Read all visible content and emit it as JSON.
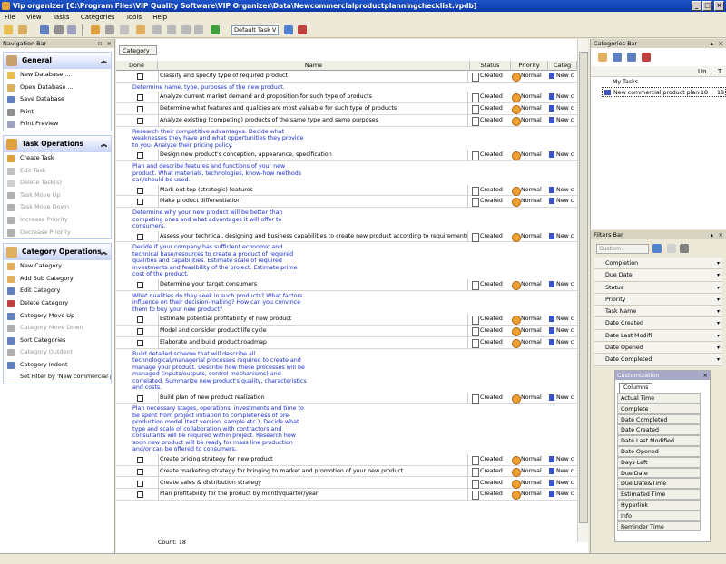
{
  "window": {
    "title": "Vip organizer [C:\\Program Files\\VIP Quality Software\\VIP Organizer\\Data\\Newcommercialproductplanningchecklist.vpdb]"
  },
  "menu": [
    "File",
    "View",
    "Tasks",
    "Categories",
    "Tools",
    "Help"
  ],
  "toolbar": {
    "filter": "Default Task V"
  },
  "nav": {
    "title": "Navigation Bar",
    "general": {
      "title": "General",
      "items": [
        "New Database ...",
        "Open Database ...",
        "Save Database",
        "Print",
        "Print Preview"
      ]
    },
    "tasks": {
      "title": "Task Operations",
      "items": [
        "Create Task",
        "Edit Task",
        "Delete Task(s)",
        "Task Move Up",
        "Task Move Down",
        "Increase Priority",
        "Decrease Priority"
      ]
    },
    "cats": {
      "title": "Category Operations",
      "items": [
        "New Category",
        "Add Sub Category",
        "Edit Category",
        "Delete Category",
        "Category Move Up",
        "Category Move Down",
        "Sort Categories",
        "Category Outdent",
        "Category Indent",
        "Set Filter by 'New commercial p..."
      ]
    }
  },
  "main": {
    "tab": "Category",
    "cols": {
      "done": "Done",
      "name": "Name",
      "status": "Status",
      "priority": "Priority",
      "cat": "Categ"
    },
    "count": "Count: 18",
    "rows": [
      {
        "name": "Classify and specify type of required product",
        "status": "Created",
        "priority": "Normal",
        "cat": "New c",
        "note": "Determine name, type, purposes of the new product."
      },
      {
        "name": "Analyze current market demand and proposition for such type of products",
        "status": "Created",
        "priority": "Normal",
        "cat": "New c"
      },
      {
        "name": "Determine what features and qualities are most valuable for such type of products",
        "status": "Created",
        "priority": "Normal",
        "cat": "New c"
      },
      {
        "name": "Analyze existing (competing) products of the same type and same purposes",
        "status": "Created",
        "priority": "Normal",
        "cat": "New c",
        "note": "Research their competitive advantages. Decide what\nweaknesses they have and what opportunities they provide\nto you. Analyze their pricing policy."
      },
      {
        "name": "Design new product's conception, appearance, specification",
        "status": "Created",
        "priority": "Normal",
        "cat": "New c",
        "note": "Plan and describe features and functions of your new\nproduct. What materials, technologies, know-how methods\ncan/should be used."
      },
      {
        "name": "Mark out top (strategic) features",
        "status": "Created",
        "priority": "Normal",
        "cat": "New c"
      },
      {
        "name": "Make product differentiation",
        "status": "Created",
        "priority": "Normal",
        "cat": "New c",
        "note": "Determine why your new product will be better than\ncompeting ones and what advantages it will offer to\nconsumers."
      },
      {
        "name": "Assess your technical, designing and business capabilities to create new product according to requirements",
        "status": "Created",
        "priority": "Normal",
        "cat": "New c",
        "note": "Decide if your company has sufficient economic and\ntechnical base/resources to create a product of required\nqualities and capabilities. Estimate scale of required\ninvestments and feasibility of the project. Estimate prime\ncost of the product."
      },
      {
        "name": "Determine your target consumers",
        "status": "Created",
        "priority": "Normal",
        "cat": "New c",
        "note": "What qualities do they seek in such products? What factors\ninfluence on their decision-making? How can you convince\nthem to buy your new product?"
      },
      {
        "name": "Estimate potential profitability of new product",
        "status": "Created",
        "priority": "Normal",
        "cat": "New c"
      },
      {
        "name": "Model and consider product life cycle",
        "status": "Created",
        "priority": "Normal",
        "cat": "New c"
      },
      {
        "name": "Elaborate and build product roadmap",
        "status": "Created",
        "priority": "Normal",
        "cat": "New c",
        "note": "Build detailed scheme that will describe all\ntechnological/managerial processes required to create and\nmanage your product. Describe how these processes will be\nmanaged (inputs/outputs, control mechanisms) and\ncorrelated. Summarize new product's quality, characteristics\nand costs."
      },
      {
        "name": "Build plan of new product realization",
        "status": "Created",
        "priority": "Normal",
        "cat": "New c",
        "note": "Plan necessary stages, operations, investments and time to\nbe spent from project initiation to completeness of pre-\nproduction model (test version, sample etc.). Decide what\ntype and scale of collaboration with contractors and\nconsultants will be required within project. Research how\nsoon new product will be ready for mass line production\nand/or can be offered to consumers."
      },
      {
        "name": "Create pricing strategy for new product",
        "status": "Created",
        "priority": "Normal",
        "cat": "New c"
      },
      {
        "name": "Create marketing strategy for bringing to market and promotion of your new product",
        "status": "Created",
        "priority": "Normal",
        "cat": "New c"
      },
      {
        "name": "Create sales & distribution strategy",
        "status": "Created",
        "priority": "Normal",
        "cat": "New c"
      },
      {
        "name": "Plan profitability for the product by month/quarter/year",
        "status": "Created",
        "priority": "Normal",
        "cat": "New c"
      }
    ]
  },
  "catbar": {
    "title": "Categories Bar",
    "col1": "Un...",
    "col2": "T",
    "root": "My Tasks",
    "child": "New commercial product plann",
    "n1": "18",
    "n2": "18"
  },
  "filters": {
    "title": "Filters Bar",
    "combo": "Custom",
    "rows": [
      "Completion",
      "Due Date",
      "Status",
      "Priority",
      "Task Name",
      "Date Created",
      "Date Last Modifi",
      "Date Opened",
      "Date Completed"
    ]
  },
  "custom": {
    "title": "Customization",
    "tab": "Columns",
    "items": [
      "Actual Time",
      "Complete",
      "Date Completed",
      "Date Created",
      "Date Last Modified",
      "Date Opened",
      "Days Left",
      "Due Date",
      "Due Date&Time",
      "Estimated Time",
      "Hyperlink",
      "Info",
      "Reminder Time"
    ]
  }
}
